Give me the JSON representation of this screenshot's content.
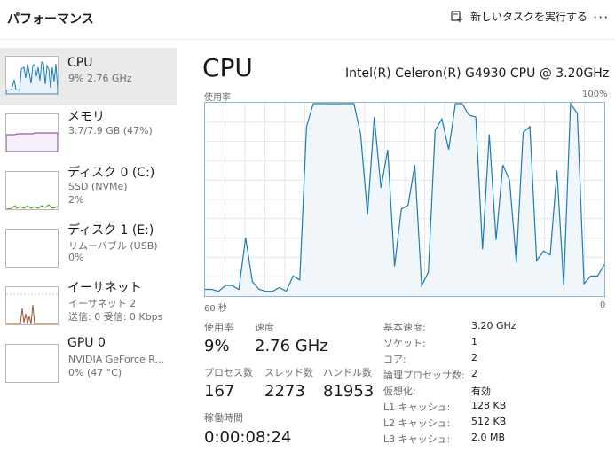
{
  "header": {
    "title": "パフォーマンス",
    "new_task_label": "新しいタスクを実行する",
    "more_label": "···"
  },
  "sidebar": {
    "items": [
      {
        "title": "CPU",
        "sub1": "9%  2.76 GHz",
        "color": "#1a7cb8"
      },
      {
        "title": "メモリ",
        "sub1": "3.7/7.9 GB (47%)",
        "color": "#8b2fa6"
      },
      {
        "title": "ディスク 0 (C:)",
        "sub1": "SSD (NVMe)",
        "sub2": "2%",
        "color": "#4c9a2a"
      },
      {
        "title": "ディスク 1 (E:)",
        "sub1": "リムーバブル (USB)",
        "sub2": "0%",
        "color": "#4c9a2a"
      },
      {
        "title": "イーサネット",
        "sub1": "イーサネット 2",
        "sub2": "送信: 0 受信: 0 Kbps",
        "color": "#a0522d"
      },
      {
        "title": "GPU 0",
        "sub1": "NVIDIA GeForce R...",
        "sub2": "0%  (47 °C)",
        "color": "#1a7cb8"
      }
    ]
  },
  "main": {
    "title": "CPU",
    "model": "Intel(R) Celeron(R) G4930 CPU @ 3.20GHz",
    "y_label": "使用率",
    "y_max_label": "100%",
    "x_left_label": "60 秒",
    "x_right_label": "0",
    "line_color": "#1a7cb8",
    "fill_color": "#f1f6fa",
    "grid_color": "#e3e8ee"
  },
  "chart_data": {
    "type": "area",
    "ylim": [
      0,
      100
    ],
    "xlabel": "60 秒",
    "ylabel": "使用率",
    "grid": true,
    "values": [
      3,
      3,
      2,
      5,
      5,
      3,
      30,
      7,
      3,
      2,
      2,
      4,
      2,
      10,
      8,
      88,
      100,
      100,
      100,
      100,
      100,
      100,
      100,
      84,
      42,
      93,
      56,
      76,
      15,
      45,
      47,
      68,
      5,
      12,
      86,
      92,
      76,
      100,
      100,
      94,
      93,
      24,
      84,
      29,
      68,
      60,
      17,
      85,
      88,
      18,
      23,
      21,
      65,
      5,
      100,
      95,
      6,
      10,
      10,
      16
    ]
  },
  "stats": {
    "usage_label": "使用率",
    "usage_value": "9%",
    "speed_label": "速度",
    "speed_value": "2.76 GHz",
    "processes_label": "プロセス数",
    "processes_value": "167",
    "threads_label": "スレッド数",
    "threads_value": "2273",
    "handles_label": "ハンドル数",
    "handles_value": "81953",
    "uptime_label": "稼働時間",
    "uptime_value": "0:00:08:24"
  },
  "details": [
    {
      "label": "基本速度:",
      "value": "3.20 GHz"
    },
    {
      "label": "ソケット:",
      "value": "1"
    },
    {
      "label": "コア:",
      "value": "2"
    },
    {
      "label": "論理プロセッサ数:",
      "value": "2"
    },
    {
      "label": "仮想化:",
      "value": "有効"
    },
    {
      "label": "L1 キャッシュ:",
      "value": "128 KB"
    },
    {
      "label": "L2 キャッシュ:",
      "value": "512 KB"
    },
    {
      "label": "L3 キャッシュ:",
      "value": "2.0 MB"
    }
  ]
}
